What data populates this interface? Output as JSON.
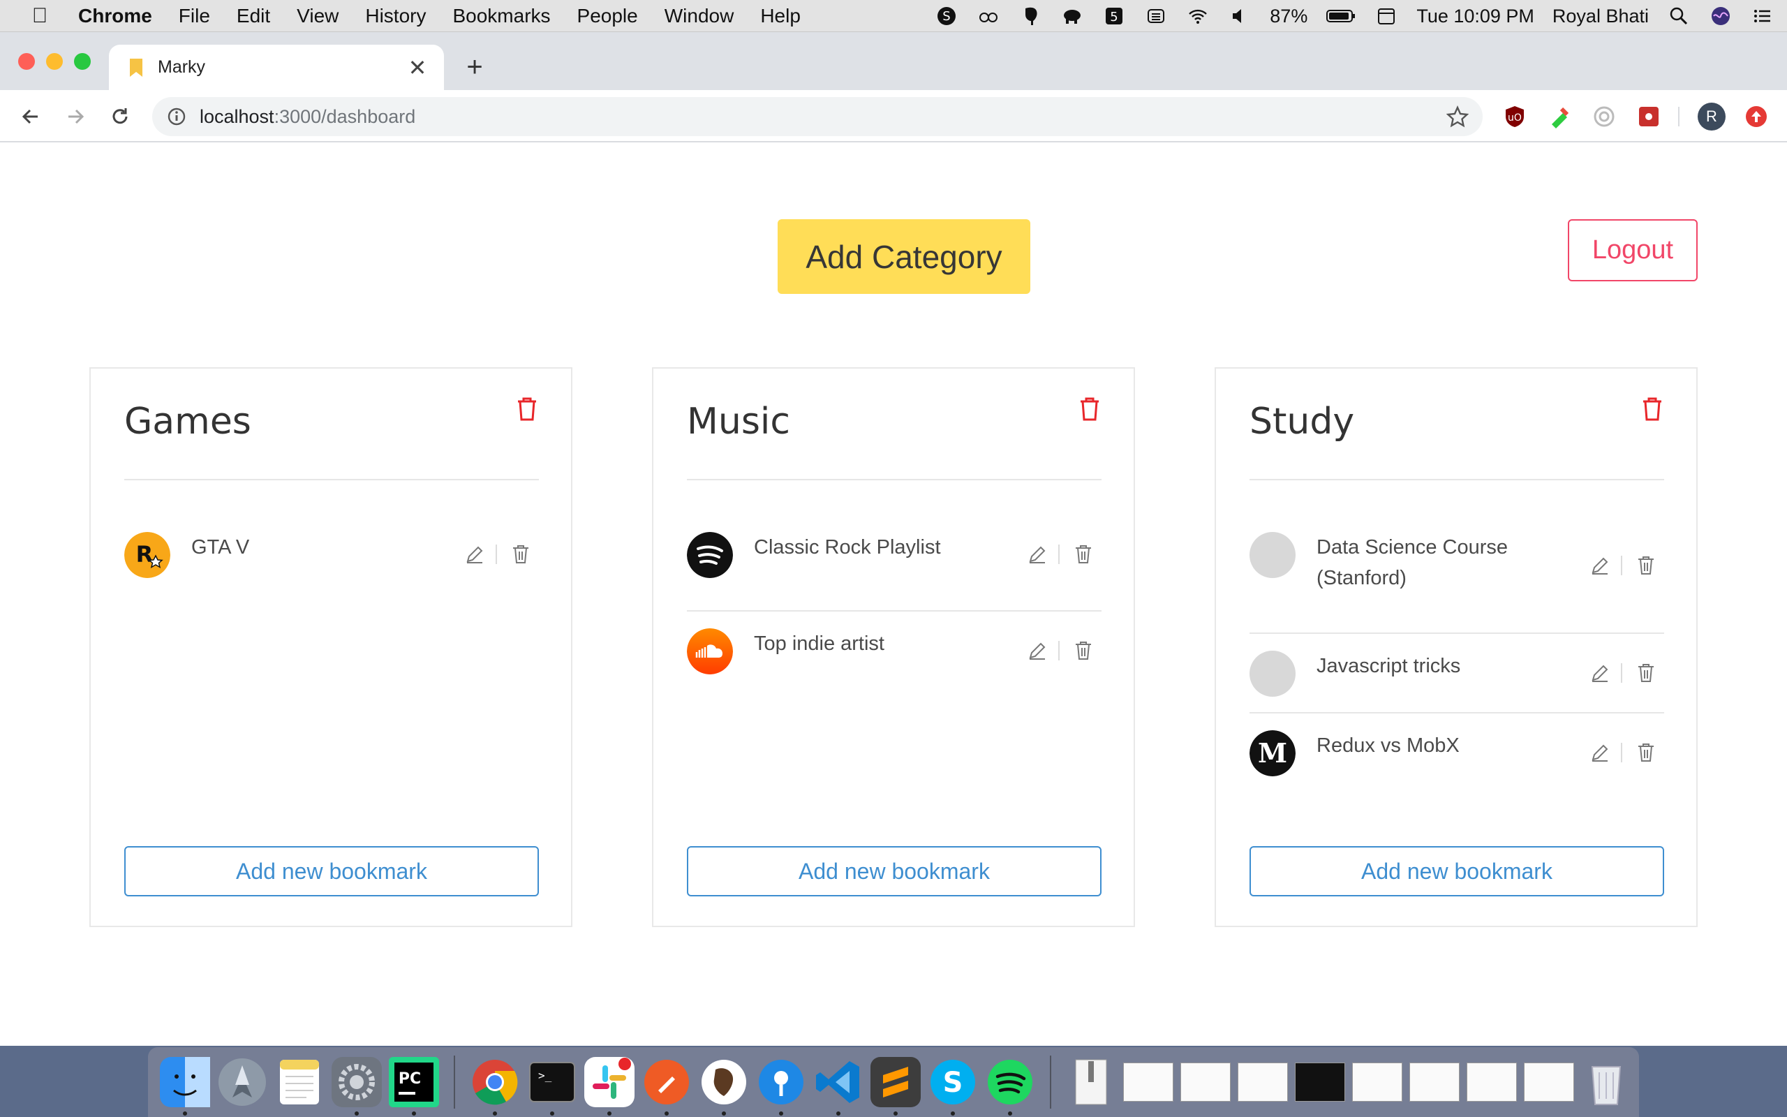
{
  "menubar": {
    "app_name": "Chrome",
    "items": [
      "File",
      "Edit",
      "View",
      "History",
      "Bookmarks",
      "People",
      "Window",
      "Help"
    ],
    "battery": "87%",
    "clock": "Tue 10:09 PM",
    "user": "Royal Bhati"
  },
  "browser": {
    "tab_title": "Marky",
    "url_host": "localhost",
    "url_path": ":3000/dashboard",
    "avatar_letter": "R"
  },
  "page": {
    "add_category_label": "Add Category",
    "logout_label": "Logout",
    "add_bookmark_label": "Add new bookmark",
    "categories": [
      {
        "title": "Games",
        "bookmarks": [
          {
            "label": "GTA V",
            "icon": "rockstar-icon"
          }
        ]
      },
      {
        "title": "Music",
        "bookmarks": [
          {
            "label": "Classic Rock Playlist",
            "icon": "spotify-icon"
          },
          {
            "label": "Top indie artist",
            "icon": "soundcloud-icon"
          }
        ]
      },
      {
        "title": "Study",
        "bookmarks": [
          {
            "label": "Data Science Course (Stanford)",
            "icon": "placeholder-icon"
          },
          {
            "label": "Javascript tricks",
            "icon": "placeholder-icon"
          },
          {
            "label": "Redux vs MobX",
            "icon": "medium-icon"
          }
        ]
      }
    ]
  },
  "colors": {
    "primary_yellow": "#ffdd57",
    "danger": "#f14668",
    "link_blue": "#3e8ed0"
  }
}
